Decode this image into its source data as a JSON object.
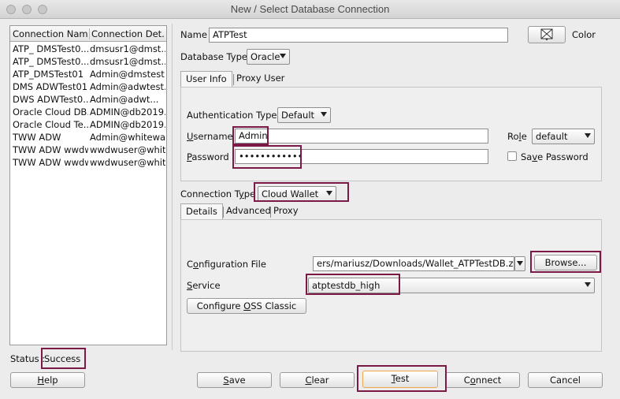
{
  "window": {
    "title": "New / Select Database Connection"
  },
  "list": {
    "columns": [
      "Connection Name",
      "Connection Det..."
    ],
    "rows": [
      {
        "name": "ATP_ DMSTest0...",
        "detail": "dmsusr1@dmst..."
      },
      {
        "name": "ATP_ DMSTest0...",
        "detail": "dmsusr1@dmst..."
      },
      {
        "name": "ATP_DMSTest01",
        "detail": "Admin@dmstest..."
      },
      {
        "name": "DMS ADWTest01",
        "detail": "Admin@adwtest..."
      },
      {
        "name": "DWS ADWTest0...",
        "detail": "Admin@adwt..."
      },
      {
        "name": "Oracle Cloud DB...",
        "detail": "ADMIN@db2019..."
      },
      {
        "name": "Oracle Cloud Te...",
        "detail": "ADMIN@db2019..."
      },
      {
        "name": "TWW ADW",
        "detail": "Admin@whitewa..."
      },
      {
        "name": "TWW ADW wwdw...",
        "detail": "wwdwuser@whit..."
      },
      {
        "name": "TWW ADW wwdw...",
        "detail": "wwdwuser@whit..."
      }
    ]
  },
  "form": {
    "name_label": "Name",
    "name_value": "ATPTest",
    "color_label": "Color",
    "dbtype_label": "Database Type",
    "dbtype_value": "Oracle",
    "tabs": [
      "User Info",
      "Proxy User"
    ],
    "auth_label": "Authentication Type",
    "auth_value": "Default",
    "username_label_u": "U",
    "username_label_rest": "sername",
    "username_value": "Admin",
    "role_label_pre": "Ro",
    "role_label_u": "l",
    "role_label_post": "e",
    "role_value": "default",
    "password_label_u": "P",
    "password_label_rest": "assword",
    "password_value": "••••••••••••",
    "save_password_pre": "Sa",
    "save_password_u": "v",
    "save_password_post": "e Password",
    "conntype_label_pre": "Connection T",
    "conntype_label_u": "y",
    "conntype_label_post": "pe",
    "conntype_value": "Cloud Wallet",
    "detail_tabs": [
      "Details",
      "Advanced",
      "Proxy"
    ],
    "config_label_pre": "C",
    "config_label_u": "o",
    "config_label_post": "nfiguration File",
    "config_value": "ers/mariusz/Downloads/Wallet_ATPTestDB.zip",
    "browse_label": "Browse...",
    "service_label_u": "S",
    "service_label_rest": "ervice",
    "service_value": "atptestdb_high",
    "oss_pre": "Configure ",
    "oss_u": "O",
    "oss_post": "SS Classic"
  },
  "status": {
    "label": "Status : ",
    "value": "Success"
  },
  "buttons": {
    "help_u": "H",
    "help_rest": "elp",
    "save_u": "S",
    "save_rest": "ave",
    "clear_u": "C",
    "clear_rest": "lear",
    "test_u": "T",
    "test_rest": "est",
    "connect_pre": "C",
    "connect_u": "o",
    "connect_post": "nnect",
    "cancel": "Cancel"
  },
  "colors": {
    "highlight": "#7b1a47"
  }
}
